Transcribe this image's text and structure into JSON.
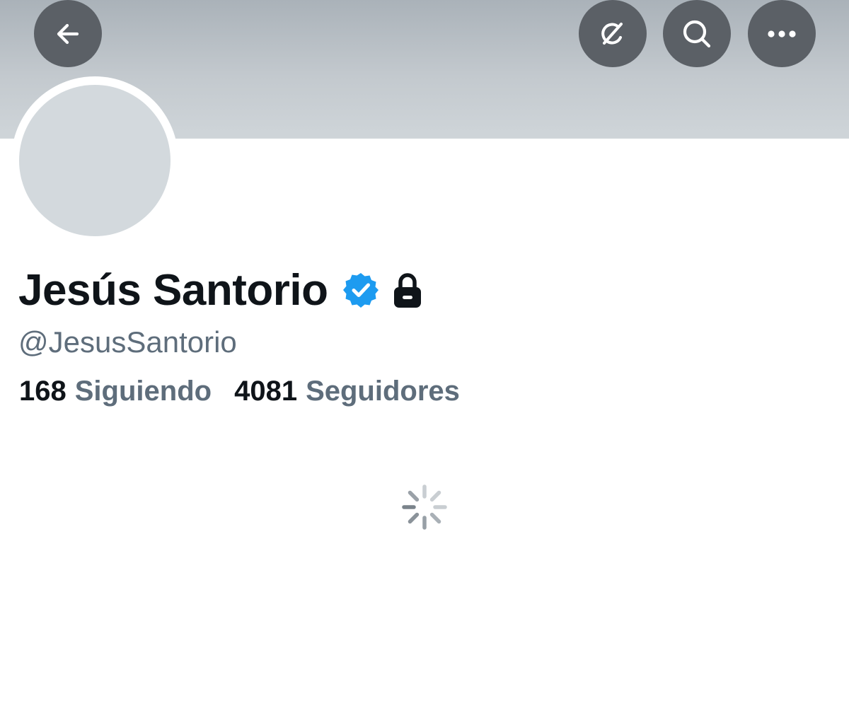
{
  "header": {
    "back_icon": "arrow-left-icon",
    "grok_icon": "grok-icon",
    "search_icon": "search-icon",
    "more_icon": "more-horizontal-icon",
    "button_color": "#5b6066"
  },
  "profile": {
    "display_name": "Jesús Santorio",
    "handle": "@JesusSantorio",
    "verified": true,
    "verified_icon": "verified-badge-icon",
    "verified_color": "#1d9bf0",
    "protected": true,
    "protected_icon": "lock-icon"
  },
  "stats": {
    "following": {
      "count": "168",
      "label": "Siguiendo"
    },
    "followers": {
      "count": "4081",
      "label": "Seguidores"
    }
  },
  "loading": {
    "icon": "loading-spinner-icon"
  },
  "colors": {
    "text_primary": "#0f1419",
    "text_secondary": "#5e6d7b",
    "avatar_placeholder": "#d3d9dd"
  }
}
